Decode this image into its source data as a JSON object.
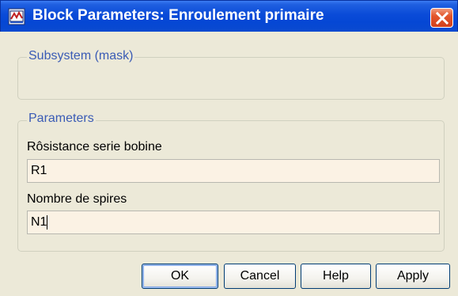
{
  "window": {
    "title": "Block Parameters: Enroulement primaire",
    "title_color": "#ffffff",
    "titlebar_color": "#0a4bd8",
    "close_icon": "close-x-icon"
  },
  "subsystem_group": {
    "legend": "Subsystem (mask)"
  },
  "parameters_group": {
    "legend": "Parameters",
    "fields": [
      {
        "label": "Rôsistance serie bobine",
        "value": "R1"
      },
      {
        "label": "Nombre de spires",
        "value": "N1"
      }
    ]
  },
  "buttons": {
    "ok": "OK",
    "cancel": "Cancel",
    "help": "Help",
    "apply": "Apply"
  },
  "colors": {
    "legend_text": "#3a5bb5",
    "input_bg": "#fbf2e4",
    "dialog_bg": "#ece9d8"
  }
}
